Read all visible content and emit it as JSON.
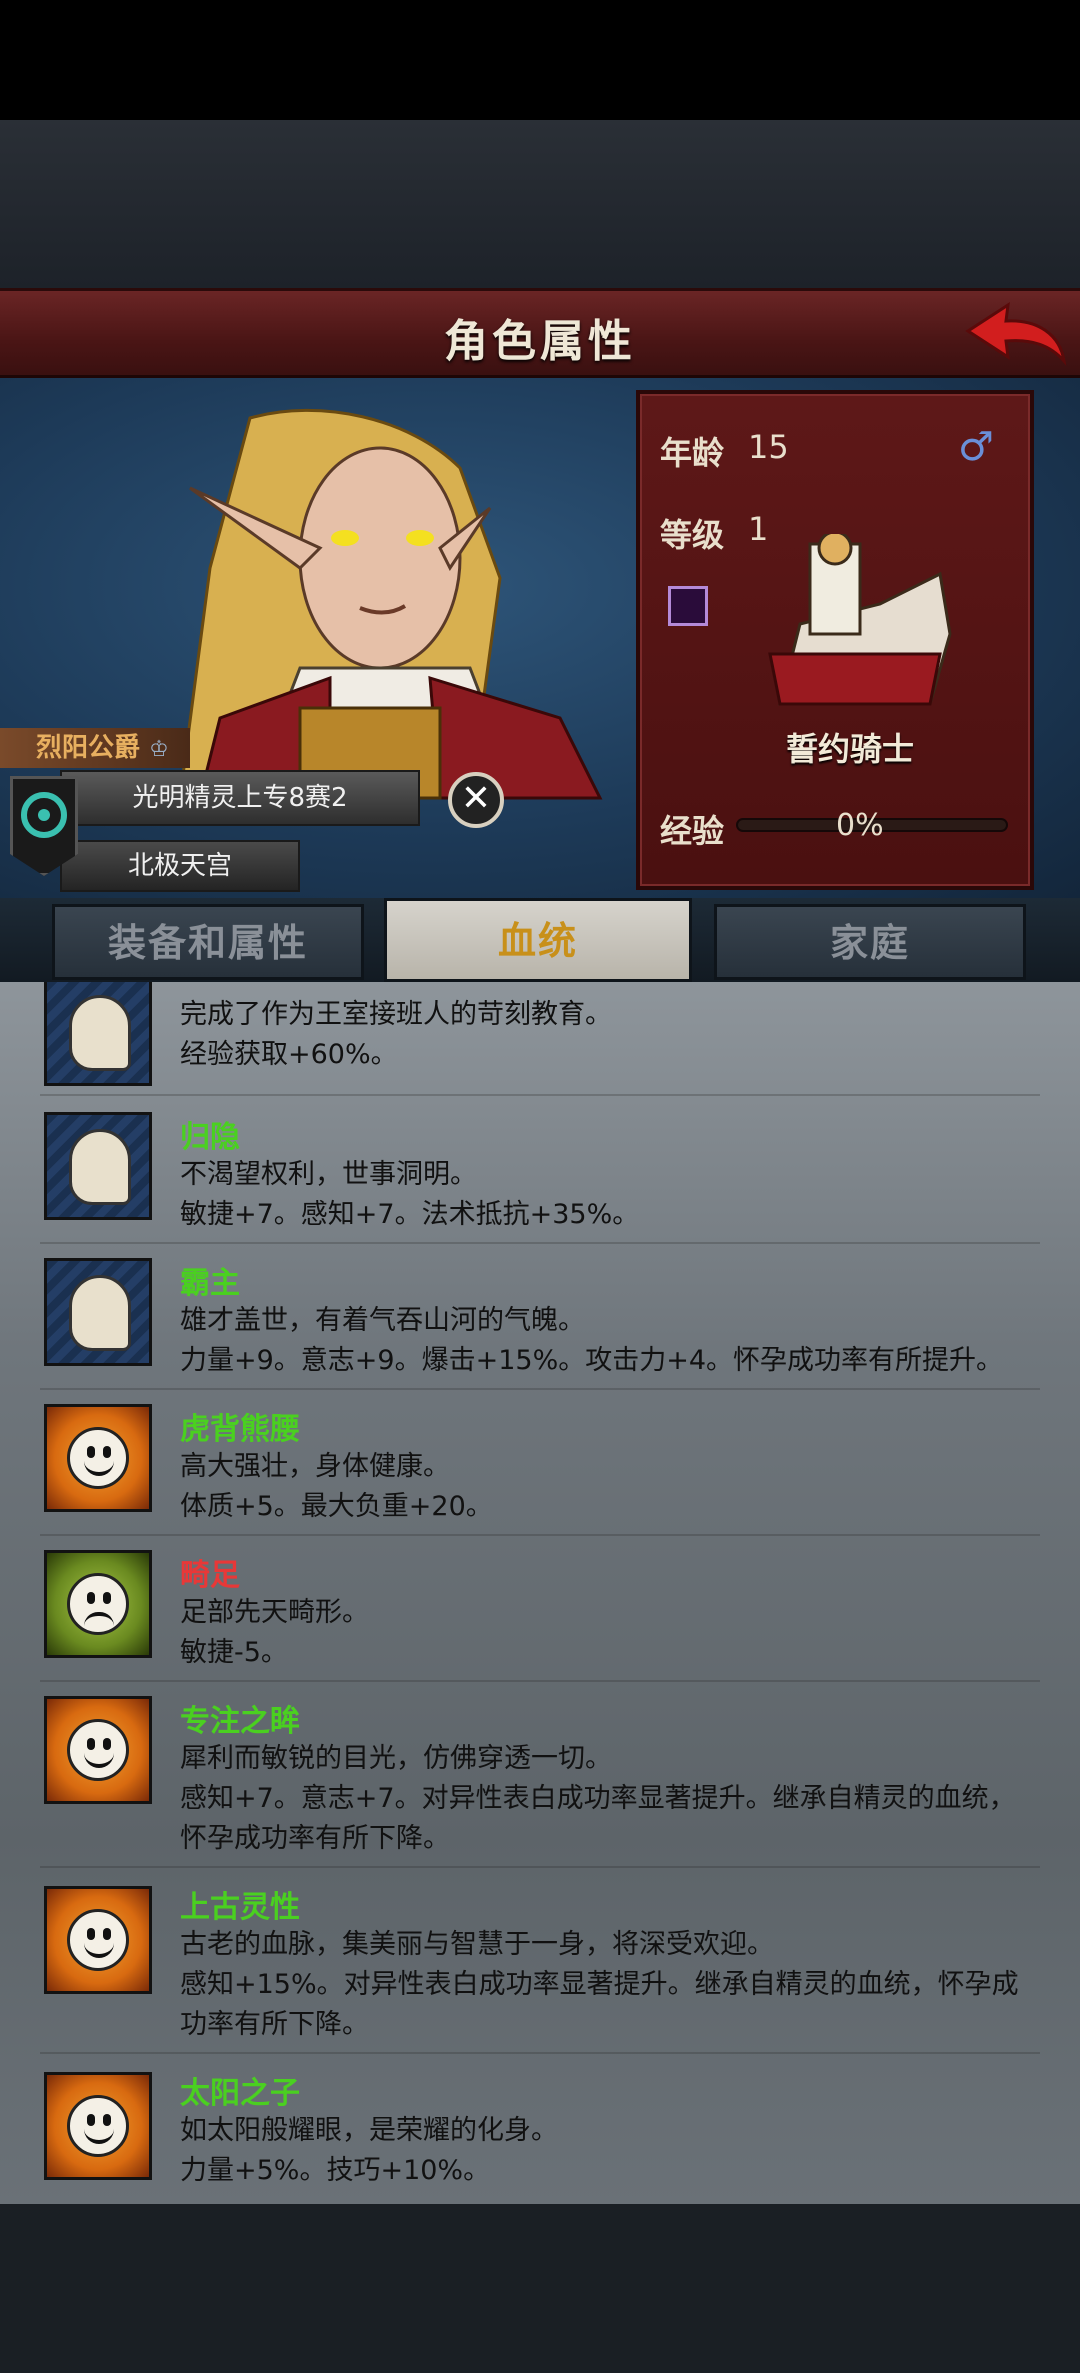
{
  "header": {
    "title": "角色属性"
  },
  "character": {
    "age_label": "年龄",
    "age": "15",
    "level_label": "等级",
    "level": "1",
    "gender_icon": "male-icon",
    "class_name": "誓约骑士",
    "xp_label": "经验",
    "xp_percent": "0%",
    "house_title": "烈阳公爵",
    "family_name": "光明精灵上专8赛2",
    "location": "北极天宫"
  },
  "tabs": [
    {
      "label": "装备和属性",
      "active": false
    },
    {
      "label": "血统",
      "active": true
    },
    {
      "label": "家庭",
      "active": false
    }
  ],
  "traits": [
    {
      "name": "",
      "icon": "muscle-icon",
      "lines": [
        "完成了作为王室接班人的苛刻教育。",
        "经验获取+60%。"
      ]
    },
    {
      "name": "归隐",
      "name_color": "#4ad020",
      "icon": "muscle-icon",
      "lines": [
        "不渴望权利，世事洞明。",
        "敏捷+7。感知+7。法术抵抗+35%。"
      ]
    },
    {
      "name": "霸主",
      "name_color": "#4ad020",
      "icon": "muscle-icon",
      "lines": [
        "雄才盖世，有着气吞山河的气魄。",
        "力量+9。意志+9。爆击+15%。攻击力+4。怀孕成功率有所提升。"
      ]
    },
    {
      "name": "虎背熊腰",
      "name_color": "#4ad020",
      "icon": "happy-face-icon",
      "lines": [
        "高大强壮，身体健康。",
        "体质+5。最大负重+20。"
      ]
    },
    {
      "name": "畸足",
      "name_color": "#e83838",
      "icon": "sad-face-icon",
      "lines": [
        "足部先天畸形。",
        "敏捷-5。"
      ]
    },
    {
      "name": "专注之眸",
      "name_color": "#4ad020",
      "icon": "happy-face-icon",
      "lines": [
        "犀利而敏锐的目光，仿佛穿透一切。",
        "感知+7。意志+7。对异性表白成功率显著提升。继承自精灵的血统，",
        "怀孕成功率有所下降。"
      ]
    },
    {
      "name": "上古灵性",
      "name_color": "#4ad020",
      "icon": "happy-face-icon",
      "lines": [
        "古老的血脉，集美丽与智慧于一身，将深受欢迎。",
        "感知+15%。对异性表白成功率显著提升。继承自精灵的血统，怀孕成",
        "功率有所下降。"
      ]
    },
    {
      "name": "太阳之子",
      "name_color": "#4ad020",
      "icon": "happy-face-icon",
      "lines": [
        "如太阳般耀眼，是荣耀的化身。",
        "力量+5%。技巧+10%。"
      ]
    }
  ]
}
